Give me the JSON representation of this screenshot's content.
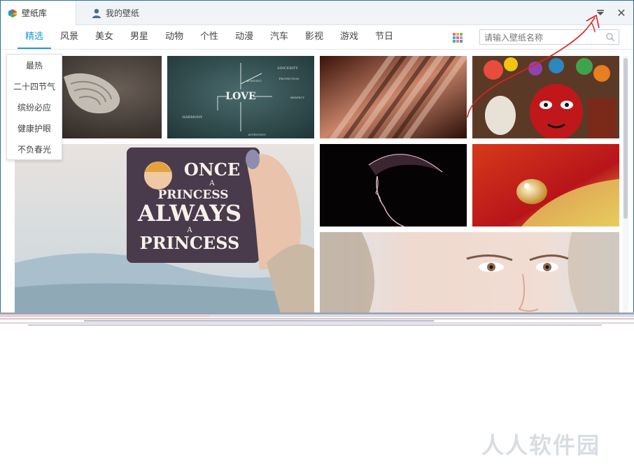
{
  "titlebar": {
    "tabs": [
      {
        "label": "壁纸库",
        "icon": "app-logo-icon",
        "active": true
      },
      {
        "label": "我的壁纸",
        "icon": "user-icon",
        "active": false
      }
    ],
    "menu_icon": "dropdown-menu-icon",
    "close_icon": "close-icon",
    "close_glyph": "✕"
  },
  "nav": {
    "categories": [
      "精选",
      "风景",
      "美女",
      "男星",
      "动物",
      "个性",
      "动漫",
      "汽车",
      "影视",
      "游戏",
      "节日"
    ],
    "active_index": 0,
    "accent": "#1d9bd6"
  },
  "search": {
    "placeholder": "请输入壁纸名称"
  },
  "dropdown": {
    "items": [
      "最热",
      "二十四节气",
      "缤纷必应",
      "健康护眼",
      "不负春光"
    ]
  },
  "thumbnails": [
    {
      "subject": "white spiral seashell on dark background"
    },
    {
      "subject": "teal chalkboard with arrows",
      "text": {
        "center": "LOVE",
        "top": "SINCERITY",
        "left_top": "BONDING",
        "right_top": "PROTECTION",
        "right": "RESPECT",
        "left": "HARMONY",
        "bottom": "ATTENTION"
      }
    },
    {
      "subject": "abstract copper diagonal stripes"
    },
    {
      "subject": "red painted opera mask with ornate headdress"
    },
    {
      "subject": "hands holding mug",
      "mug_text": [
        "ONCE",
        "A",
        "PRINCESS",
        "ALWAYS",
        "A",
        "PRINCESS"
      ]
    },
    {
      "subject": "woman in wide hat silhouette on black"
    },
    {
      "subject": "water droplet on red and yellow leaf"
    },
    {
      "subject": "close-up of woman's face with light brown eyes"
    }
  ],
  "watermark": "人人软件园"
}
